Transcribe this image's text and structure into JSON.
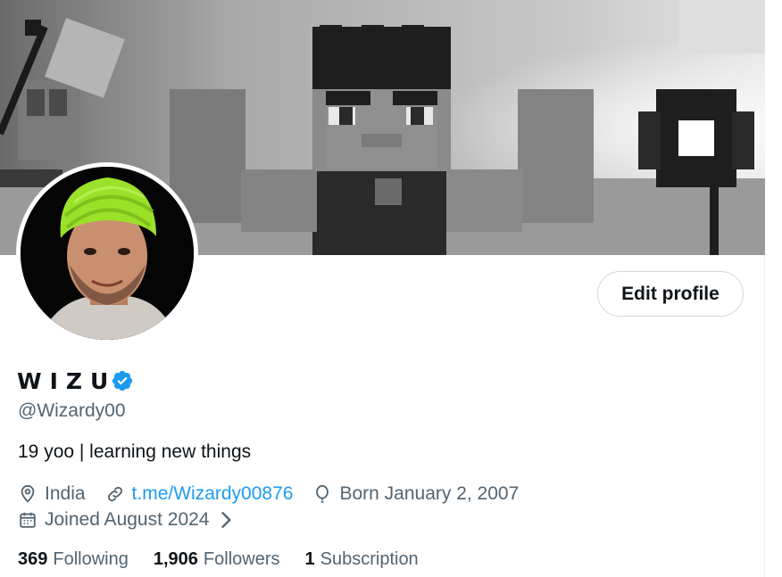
{
  "profile": {
    "display_name": "WIZU",
    "handle": "@Wizardy00",
    "bio": "19 yoo | learning new things",
    "location": "India",
    "website": "t.me/Wizardy00876",
    "birthday": "Born January 2, 2007",
    "joined": "Joined August 2024",
    "verified": true
  },
  "actions": {
    "edit_profile_label": "Edit profile"
  },
  "stats": [
    {
      "count": "369",
      "label": "Following"
    },
    {
      "count": "1,906",
      "label": "Followers"
    },
    {
      "count": "1",
      "label": "Subscription"
    }
  ],
  "icons": {
    "verified": "verified-badge-icon",
    "location": "location-pin-icon",
    "website": "link-icon",
    "birthday": "balloon-icon",
    "joined": "calendar-icon",
    "joined_more": "chevron-right-icon"
  },
  "colors": {
    "accent": "#1d9bf0",
    "text_primary": "#0f1419",
    "text_secondary": "#536471",
    "border": "#cfd9de",
    "turban": "#9be12a"
  }
}
